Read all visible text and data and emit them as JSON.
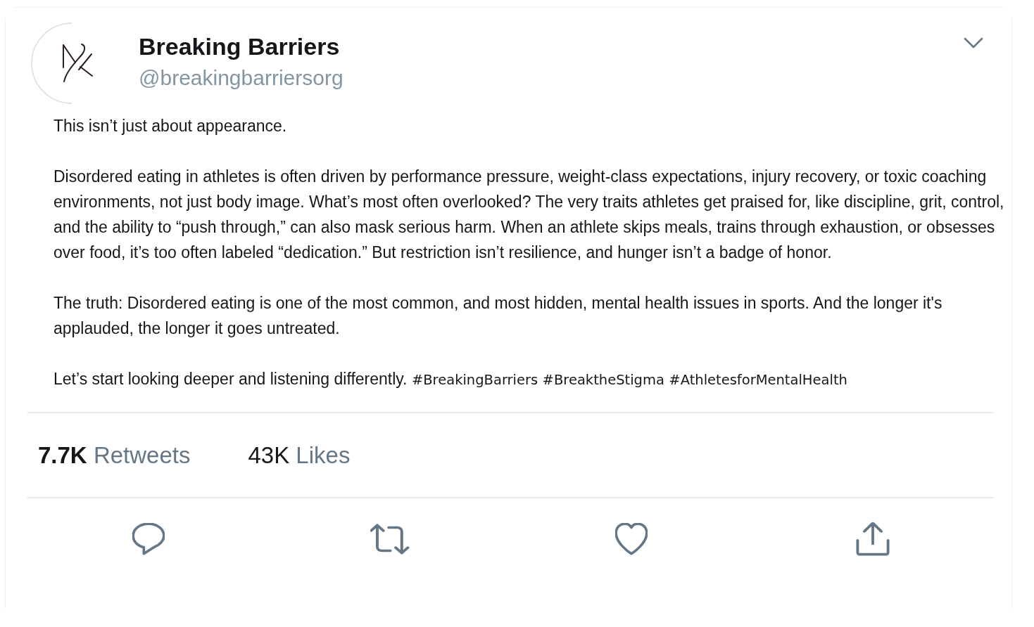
{
  "author": {
    "name": "Breaking Barriers",
    "handle": "@breakingbarriersorg"
  },
  "paragraphs": [
    {
      "text": "This isn’t just about appearance."
    },
    {
      "text": "Disordered eating in athletes is often driven by performance pressure, weight-class expectations, injury recovery, or toxic coaching environments, not just body image. What’s most often overlooked? The very traits athletes get praised for, like discipline, grit, control, and the ability to “push through,” can also mask serious harm. When an athlete skips meals, trains through exhaustion, or obsesses over food, it’s too often labeled “dedication.” But restriction isn’t resilience, and hunger isn’t a badge of honor."
    },
    {
      "text": "The truth: Disordered eating is one of the most common, and most hidden, mental health issues in sports. And the longer it's applauded, the longer it goes untreated."
    },
    {
      "text": "Let’s start looking deeper and listening differently.",
      "hashtags": [
        "#BreakingBarriers",
        "#BreaktheStigma",
        "#AthletesforMentalHealth"
      ]
    }
  ],
  "stats": [
    {
      "count": "7.7K",
      "label": "Retweets",
      "count_bold": true
    },
    {
      "count": "43K",
      "label": "Likes",
      "count_bold": false
    }
  ]
}
